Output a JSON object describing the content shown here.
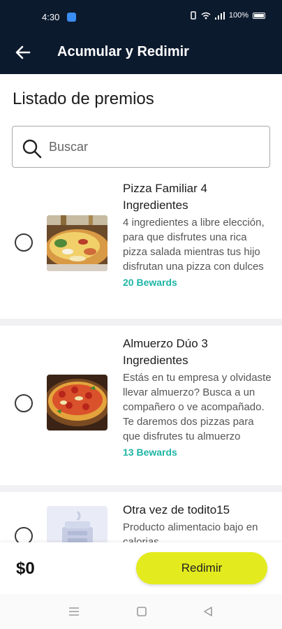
{
  "status_bar": {
    "time": "4:30",
    "battery": "100%"
  },
  "app_bar": {
    "title": "Acumular y Redimir"
  },
  "section_title": "Listado de premios",
  "search": {
    "placeholder": "Buscar",
    "value": ""
  },
  "rewards": [
    {
      "name": "Pizza Familiar 4 Ingredientes",
      "description": "4 ingredientes a libre elección, para que disfrutes una rica pizza salada mientras tus hijo disfrutan una pizza con dulces",
      "points": "20 Bewards"
    },
    {
      "name": "Almuerzo Dúo 3 Ingredientes",
      "description": "Estás en tu empresa y olvidaste llevar almuerzo? Busca a un compañero o ve acompañado. Te daremos dos pizzas para que disfrutes tu almuerzo",
      "points": "13 Bewards"
    },
    {
      "name": "Otra vez de todito15",
      "description": "Producto alimentacio bajo en calorias",
      "points": ""
    }
  ],
  "footer": {
    "total": "$0",
    "redeem_label": "Redimir"
  },
  "colors": {
    "header": "#0c1a2e",
    "accent": "#e3eb1e",
    "points": "#1db5a5"
  },
  "icons": [
    "back-arrow-icon",
    "search-icon",
    "menu-icon",
    "home-square-icon",
    "back-triangle-icon"
  ]
}
